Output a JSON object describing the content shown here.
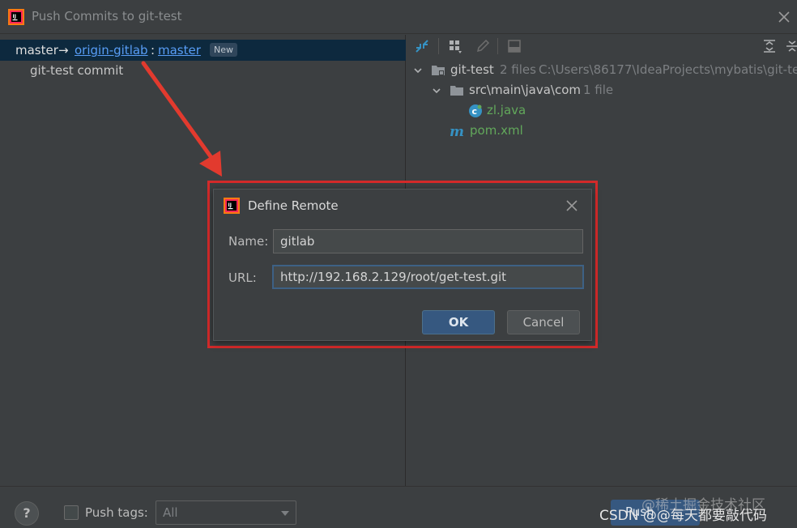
{
  "window": {
    "title": "Push Commits to git-test"
  },
  "left": {
    "branch": {
      "local": "master",
      "arrow": "→",
      "remote": "origin-gitlab",
      "colon": ":",
      "target": "master",
      "badge": "New"
    },
    "commits": [
      "git-test commit"
    ]
  },
  "right": {
    "toolbar_icons": [
      "expand-branches-icon",
      "group-icon",
      "edit-icon",
      "diff-icon",
      "expand-all-icon",
      "collapse-all-icon"
    ],
    "tree": {
      "root": {
        "name": "git-test",
        "count": "2 files",
        "path": "C:\\Users\\86177\\IdeaProjects\\mybatis\\git-te"
      },
      "folder": {
        "name": "src\\main\\java\\com",
        "count": "1 file"
      },
      "files": [
        {
          "name": "zl.java",
          "icon": "java-class-icon"
        },
        {
          "name": "pom.xml",
          "icon": "maven-icon"
        }
      ]
    }
  },
  "dialog": {
    "title": "Define Remote",
    "name_label": "Name:",
    "name_value": "gitlab",
    "url_label": "URL:",
    "url_value": "http://192.168.2.129/root/get-test.git",
    "ok_label": "OK",
    "cancel_label": "Cancel"
  },
  "bottom": {
    "help_label": "?",
    "push_tags_label": "Push tags:",
    "push_tags_value": "All",
    "push_label": "Push",
    "watermark_top": "@稀土掘金技术社区",
    "watermark_bottom": "CSDN @@每天都要敲代码"
  },
  "colors": {
    "accent": "#365880",
    "link": "#589df6",
    "highlight": "#d42a2a",
    "added_file": "#62a85b"
  }
}
